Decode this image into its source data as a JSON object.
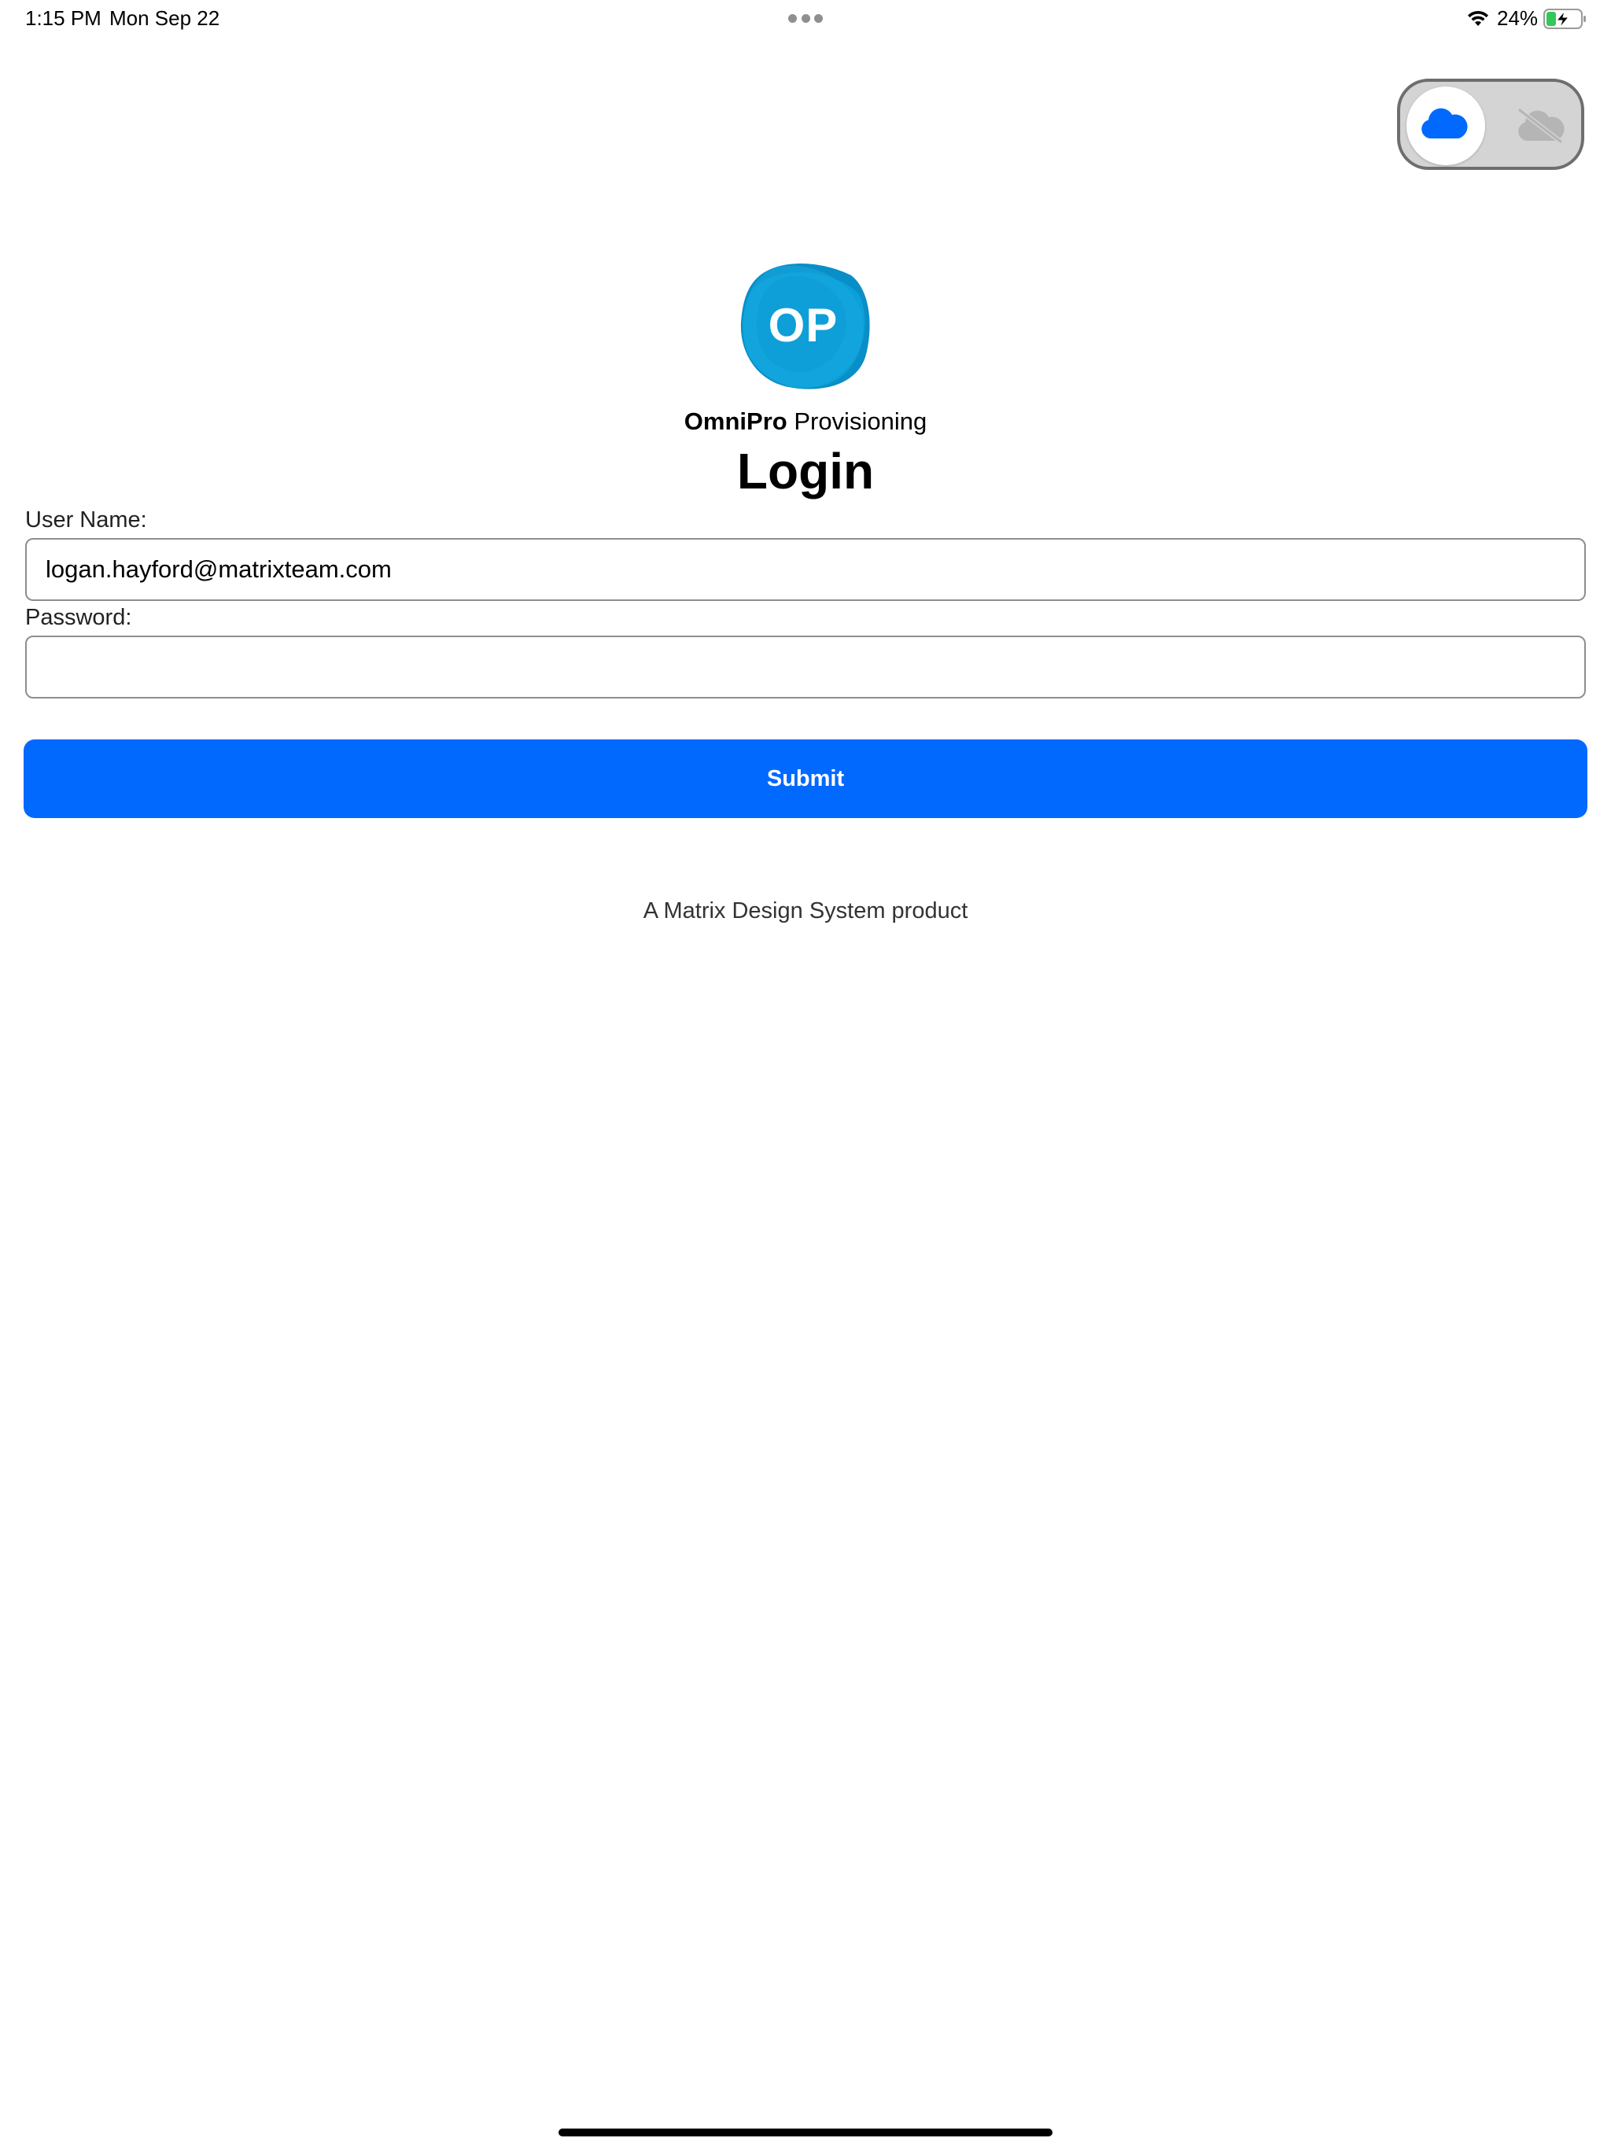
{
  "status_bar": {
    "time": "1:15 PM",
    "date": "Mon Sep 22",
    "battery_percent": "24%",
    "battery_level": 0.24,
    "icons": [
      "wifi-icon",
      "battery-charging-icon"
    ]
  },
  "mode_toggle": {
    "selected": "online",
    "icons": [
      "cloud-icon",
      "cloud-off-icon"
    ],
    "colors": {
      "active_icon": "#0269ff",
      "inactive_icon": "#b5b5b5",
      "track": "#d4d4d4"
    }
  },
  "header": {
    "logo_text": "OP",
    "app_name_bold": "OmniPro",
    "app_name_rest": " Provisioning",
    "title": "Login"
  },
  "form": {
    "username_label": "User Name:",
    "username_value": "logan.hayford@matrixteam.com",
    "password_label": "Password:",
    "password_value": "",
    "submit_label": "Submit"
  },
  "footer": {
    "text": "A Matrix Design System product"
  },
  "colors": {
    "primary": "#0269ff",
    "logo_blue": "#0a9ad6"
  }
}
